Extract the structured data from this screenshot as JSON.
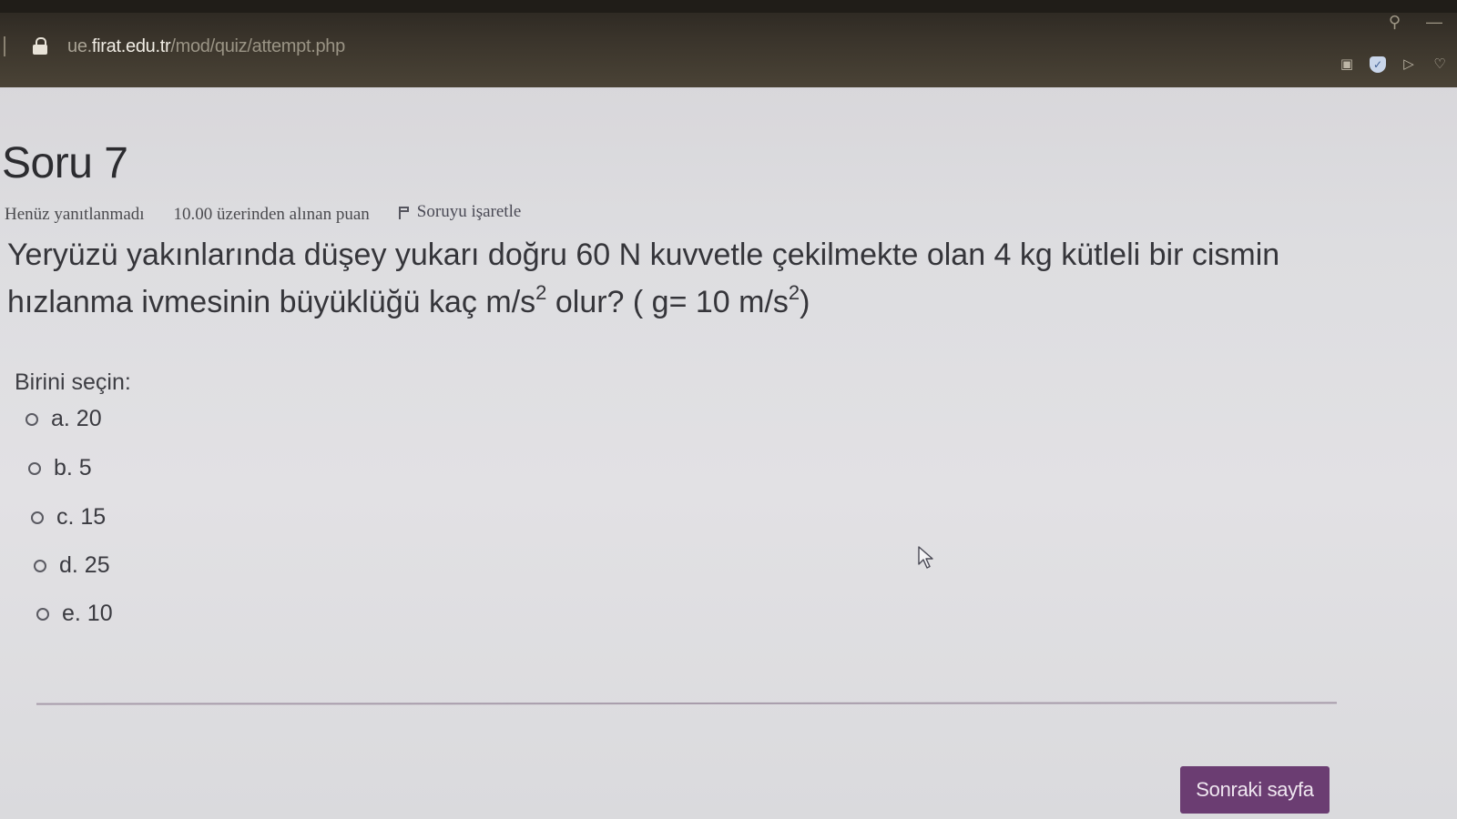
{
  "browser": {
    "url_prefix": "ue.",
    "url_host": "firat.edu.tr",
    "url_path": "/mod/quiz/attempt.php",
    "icons": [
      "camera-icon",
      "shield-icon",
      "send-icon",
      "heart-icon"
    ],
    "top_icons": [
      "search-icon",
      "minimize-icon"
    ]
  },
  "question": {
    "title": "Soru 7",
    "state": "Henüz yanıtlanmadı",
    "grade": "10.00 üzerinden alınan puan",
    "flag_label": "Soruyu işaretle",
    "text_part1": "Yeryüzü yakınlarında düşey yukarı doğru 60 N kuvvetle çekilmekte olan 4 kg kütleli bir cismin hızlanma ivmesinin büyüklüğü kaç m/s",
    "exp1": "2",
    "text_part2": " olur? ( g= 10 m/s",
    "exp2": "2",
    "text_part3": ")",
    "prompt": "Birini seçin:",
    "answers": [
      {
        "label": "a. 20",
        "selected": false
      },
      {
        "label": "b. 5",
        "selected": false
      },
      {
        "label": "c. 15",
        "selected": false
      },
      {
        "label": "d. 25",
        "selected": false
      },
      {
        "label": "e. 10",
        "selected": false
      }
    ]
  },
  "navigation": {
    "next_label": "Sonraki sayfa"
  },
  "colors": {
    "accent": "#6b3d72",
    "background": "#dddde0",
    "browser_bar": "#3a342b"
  }
}
